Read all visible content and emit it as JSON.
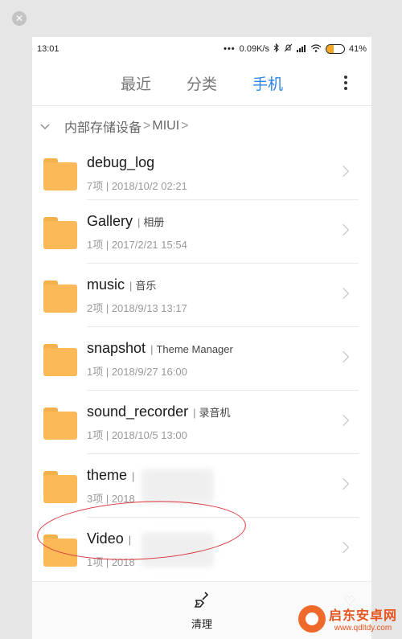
{
  "window": {
    "close_glyph": "✕"
  },
  "status_bar": {
    "time": "13:01",
    "dots": "•••",
    "network_speed": "0.09K/s",
    "battery_level": 0.41,
    "battery_text": "41%"
  },
  "tabs": [
    {
      "label": "最近",
      "active": false
    },
    {
      "label": "分类",
      "active": false
    },
    {
      "label": "手机",
      "active": true
    }
  ],
  "breadcrumb": {
    "root": "内部存储设备",
    "separator": ">",
    "current": "MIUI",
    "trail": ">"
  },
  "files": [
    {
      "name": "debug_log",
      "tag": "",
      "meta": "7项 | 2018/10/2 02:21"
    },
    {
      "name": "Gallery",
      "tag": "相册",
      "meta": "1项 | 2017/2/21 15:54"
    },
    {
      "name": "music",
      "tag": "音乐",
      "meta": "2项 | 2018/9/13 13:17"
    },
    {
      "name": "snapshot",
      "tag": "Theme Manager",
      "meta": "1项 | 2018/9/27 16:00"
    },
    {
      "name": "sound_recorder",
      "tag": "录音机",
      "meta": "1项 | 2018/10/5 13:00"
    },
    {
      "name": "theme",
      "tag": "",
      "meta": "3项 | 2018"
    },
    {
      "name": "Video",
      "tag": "",
      "meta": "1项 | 2018"
    }
  ],
  "bottom_bar": {
    "clean_label": "清理"
  },
  "watermark": {
    "title": "启东安卓网",
    "url": "www.qdltdy.com"
  },
  "colors": {
    "accent": "#2b84e6",
    "folder": "#fbb957",
    "annotation": "#d8343a"
  }
}
